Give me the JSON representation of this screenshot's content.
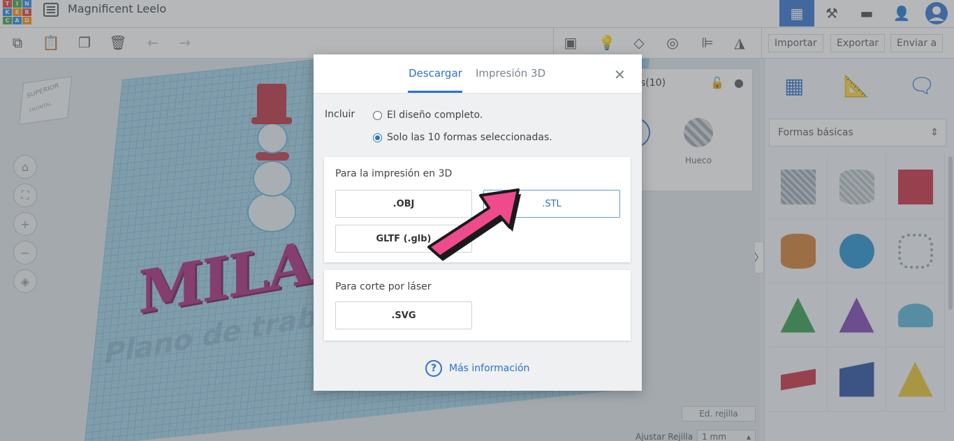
{
  "app": {
    "logo_letters": [
      "T",
      "I",
      "N",
      "K",
      "E",
      "R",
      "C",
      "A",
      "D"
    ],
    "logo_colors": [
      "#e53935",
      "#43a047",
      "#1e88e5",
      "#1e88e5",
      "#fb8c00",
      "#e53935",
      "#43a047",
      "#1e88e5",
      "#fb8c00"
    ],
    "design_name": "Magnificent Leelo"
  },
  "toolbar": {
    "import_label": "Importar",
    "export_label": "Exportar",
    "send_label": "Enviar a"
  },
  "workspace": {
    "viewcube_top": "SUPERIOR",
    "viewcube_front": "FRONTAL",
    "plane_text": "Plano de trabajo",
    "model_text": "MILAG",
    "edit_grid_label": "Ed. rejilla",
    "snap_grid_label": "Ajustar Rejilla",
    "snap_grid_value": "1 mm"
  },
  "inspector": {
    "title": "s(10)",
    "hole_label": "Hueco"
  },
  "library": {
    "category_select": "Formas básicas",
    "shapes": [
      {
        "name": "box-striped",
        "color": "#9aa7b3"
      },
      {
        "name": "cylinder-striped",
        "color": "#b3bcc4"
      },
      {
        "name": "box",
        "color": "#c8283e"
      },
      {
        "name": "cylinder",
        "color": "#d27a2c"
      },
      {
        "name": "sphere",
        "color": "#1f8ed0"
      },
      {
        "name": "scribble",
        "color": "#8aa3b4"
      },
      {
        "name": "roof",
        "color": "#2e9a4a"
      },
      {
        "name": "cone",
        "color": "#7a3fb0"
      },
      {
        "name": "round-roof",
        "color": "#55b3d6"
      },
      {
        "name": "text",
        "color": "#c8283e"
      },
      {
        "name": "wedge",
        "color": "#244c9e"
      },
      {
        "name": "pyramid",
        "color": "#e8c42a"
      }
    ]
  },
  "dialog": {
    "tabs": [
      "Descargar",
      "Impresión 3D"
    ],
    "active_tab": "Descargar",
    "include_label": "Incluir",
    "option_full": "El diseño completo.",
    "option_selected": "Solo las 10 formas seleccionadas.",
    "selected_option": "option_selected",
    "print_section_title": "Para la impresión en 3D",
    "print_formats": [
      ".OBJ",
      ".STL",
      "GLTF (.glb)"
    ],
    "highlighted_format": ".STL",
    "laser_section_title": "Para corte por láser",
    "laser_formats": [
      ".SVG"
    ],
    "more_info_label": "Más información",
    "accent_color": "#2f6fd0",
    "annotation_arrow_color": "#ee4a8c"
  }
}
